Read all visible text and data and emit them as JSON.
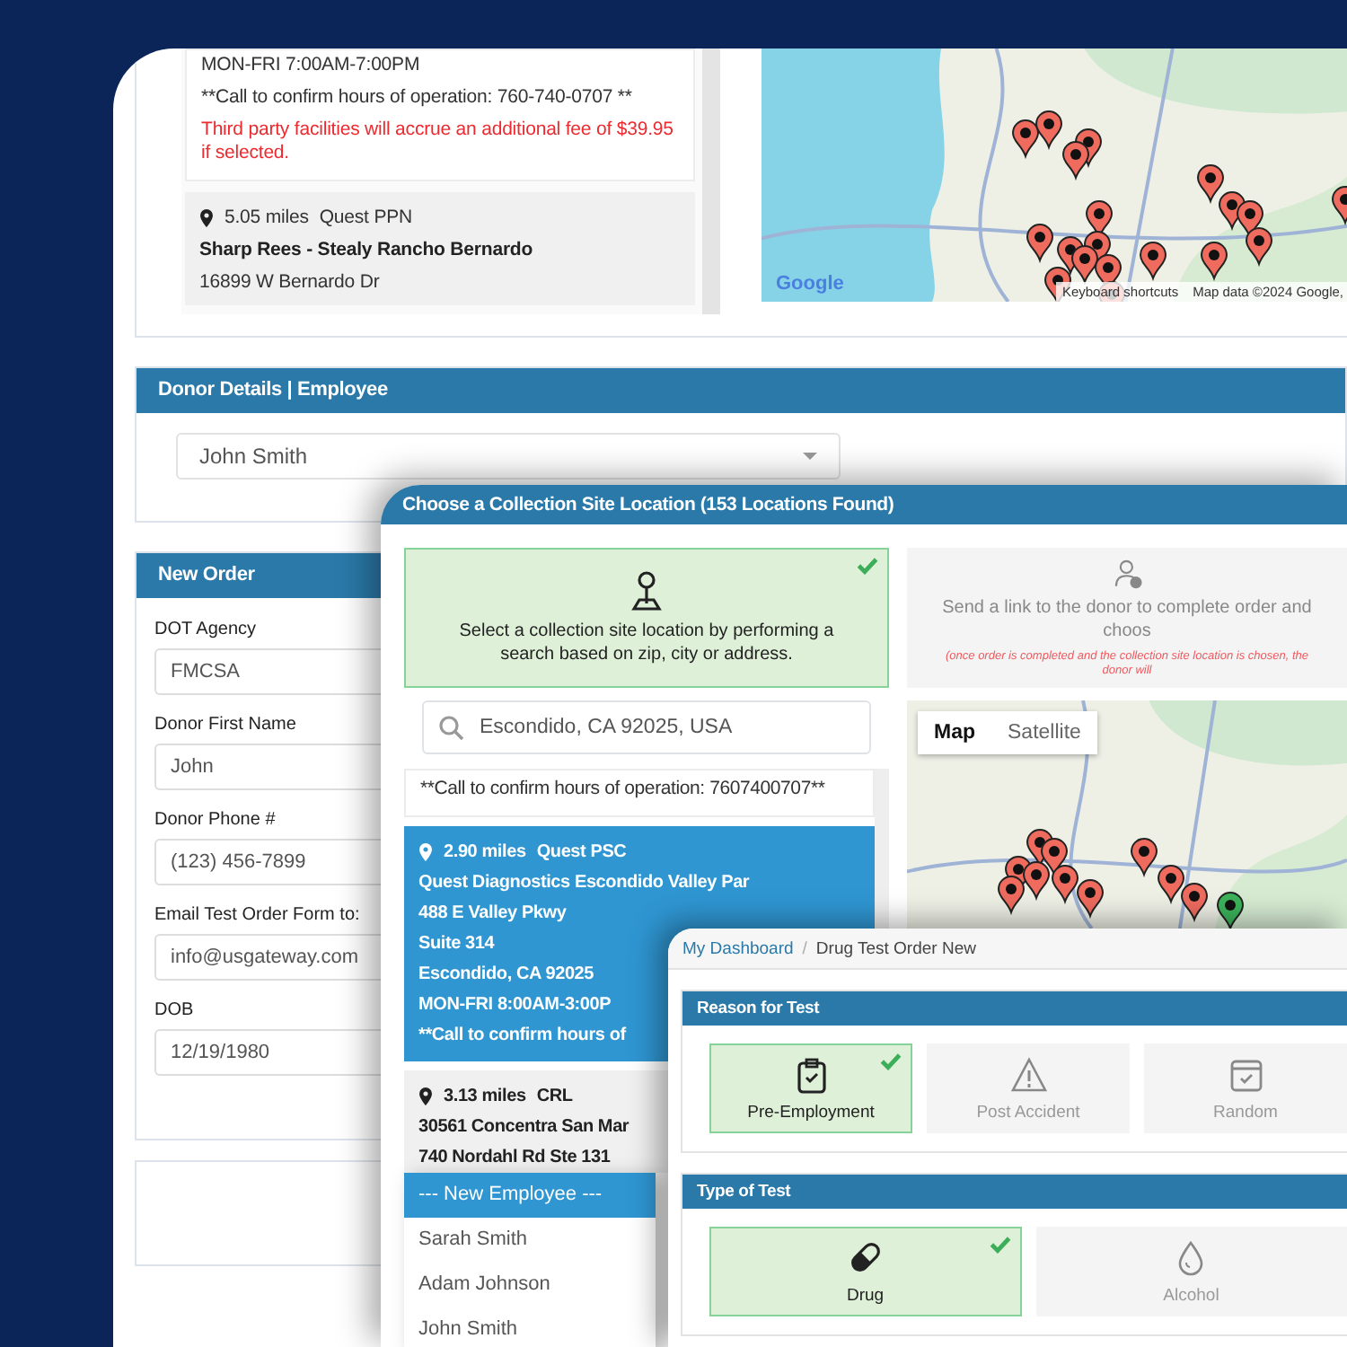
{
  "background_window": {
    "site_list": [
      {
        "kind": "partial",
        "hours": "MON-FRI 7:00AM-7:00PM",
        "note": "**Call to confirm hours of operation: 760-740-0707 **",
        "fee_notice": "Third party facilities will accrue an additional fee of $39.95 if selected."
      },
      {
        "kind": "site",
        "distance": "5.05 miles",
        "provider": "Quest PPN",
        "name": "Sharp Rees - Stealy Rancho Bernardo",
        "address": "16899 W Bernardo Dr"
      }
    ],
    "map": {
      "logo": "Google",
      "attribution": [
        "Keyboard shortcuts",
        "Map data ©2024 Google,"
      ]
    },
    "donor_details": {
      "title": "Donor Details | Employee",
      "employee_select": {
        "value": "John Smith"
      },
      "options": [
        {
          "label": "--- New Employee ---",
          "selected": true
        },
        {
          "label": "Sarah Smith",
          "selected": false
        },
        {
          "label": "Adam Johnson",
          "selected": false
        },
        {
          "label": "John Smith",
          "selected": false
        }
      ]
    },
    "new_order": {
      "title": "New Order",
      "fields": [
        {
          "label": "DOT Agency",
          "value": "FMCSA"
        },
        {
          "label": "Donor First Name",
          "value": "John"
        },
        {
          "label": "Donor Phone #",
          "value": "(123) 456-7899"
        },
        {
          "label": "Email Test Order Form to:",
          "value": "info@usgateway.com"
        },
        {
          "label": "DOB",
          "value": "12/19/1980"
        }
      ]
    }
  },
  "collection_site_dialog": {
    "title": "Choose a Collection Site Location (153 Locations Found)",
    "options": [
      {
        "kind": "search",
        "text": "Select a collection site location by performing a search based on zip, city or address.",
        "selected": true
      },
      {
        "kind": "link",
        "text": "Send a link to the donor to complete order and choos",
        "notice": "(once order is completed and the collection site location is chosen, the donor will",
        "selected": false
      }
    ],
    "search": {
      "value": "Escondido, CA 92025, USA"
    },
    "sites": [
      {
        "kind": "partial",
        "lines": [
          "**Call to confirm hours of operation: 7607400707**"
        ],
        "selected": false
      },
      {
        "kind": "site",
        "distance": "2.90 miles",
        "provider": "Quest PSC",
        "lines": [
          "Quest Diagnostics Escondido Valley Par",
          "488 E Valley Pkwy",
          "Suite 314",
          "Escondido, CA 92025",
          "MON-FRI 8:00AM-3:00P",
          "**Call to confirm hours of"
        ],
        "selected": true
      },
      {
        "kind": "site",
        "distance": "3.13 miles",
        "provider": "CRL",
        "lines": [
          "30561 Concentra San Mar",
          "740 Nordahl Rd Ste 131"
        ],
        "selected": false
      }
    ],
    "map_types": [
      {
        "label": "Map",
        "selected": true
      },
      {
        "label": "Satellite",
        "selected": false
      }
    ]
  },
  "order_window": {
    "breadcrumb": {
      "separator": "/",
      "items": [
        {
          "label": "My Dashboard",
          "kind": "link"
        },
        {
          "label": "Drug Test Order New",
          "kind": "current"
        }
      ]
    },
    "sections": [
      {
        "title": "Reason for Test",
        "options": [
          {
            "label": "Pre-Employment",
            "selected": true
          },
          {
            "label": "Post Accident",
            "selected": false
          },
          {
            "label": "Random",
            "selected": false
          }
        ]
      },
      {
        "title": "Type of Test",
        "options": [
          {
            "label": "Drug",
            "selected": true
          },
          {
            "label": "Alcohol",
            "selected": false
          }
        ]
      }
    ]
  }
}
